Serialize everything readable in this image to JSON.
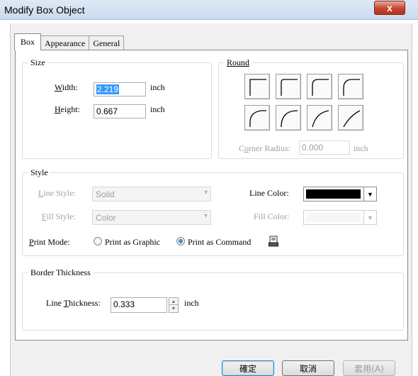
{
  "window": {
    "title": "Modify Box Object",
    "close_glyph": "x"
  },
  "tabs": [
    {
      "label": "Box",
      "active": true
    },
    {
      "label": "Appearance",
      "active": false
    },
    {
      "label": "General",
      "active": false
    }
  ],
  "size": {
    "title": "Size",
    "width_label": "Width:",
    "width_value": "2.219",
    "width_unit": "inch",
    "height_label": "Height:",
    "height_value": "0.667",
    "height_unit": "inch"
  },
  "round": {
    "title": "Round",
    "corner_radius_label": "Corner Radius:",
    "corner_radius_value": "0.000",
    "corner_radius_unit": "inch"
  },
  "style": {
    "title": "Style",
    "line_style_label": "Line Style:",
    "line_style_value": "Solid",
    "fill_style_label": "Fill Style:",
    "fill_style_value": "Color",
    "line_color_label": "Line Color:",
    "line_color": "#000000",
    "fill_color_label": "Fill Color:",
    "print_mode_label": "Print Mode:",
    "print_graphic_label": "Print as Graphic",
    "print_command_label": "Print as Command",
    "print_mode_selected": "Print as Command"
  },
  "border": {
    "title": "Border Thickness",
    "line_thickness_label": "Line Thickness:",
    "line_thickness_value": "0.333",
    "line_thickness_unit": "inch"
  },
  "buttons": {
    "ok_label": "確定",
    "cancel_label": "取消",
    "apply_label": "套用(A)"
  },
  "colors": {
    "accent": "#3399ff",
    "close_red": "#c7452d"
  }
}
